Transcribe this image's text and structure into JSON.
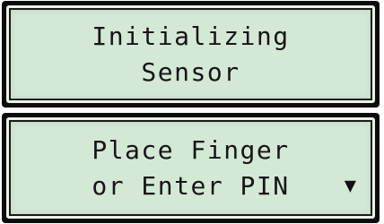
{
  "screens": [
    {
      "lines": [
        "Initializing",
        "Sensor"
      ]
    },
    {
      "lines": [
        "Place Finger",
        "or Enter PIN"
      ],
      "scroll_indicator": "▼",
      "scroll_indicator_icon": "down-triangle-icon"
    }
  ],
  "colors": {
    "bezel": "#0c0c0c",
    "screen_background": "#d4e8d6",
    "text": "#161616"
  }
}
